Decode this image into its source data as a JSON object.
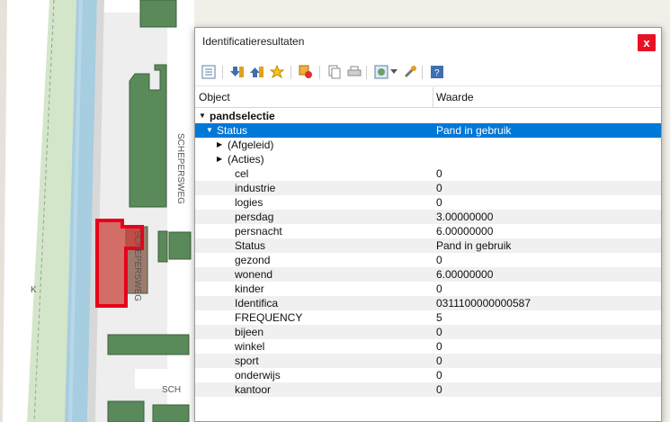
{
  "map": {
    "street_labels": [
      "SCHEPERSWEG",
      "SCHEPERSWEG",
      "SCH",
      "PE",
      "ERS",
      "K"
    ]
  },
  "dialog": {
    "title": "Identificatieresultaten",
    "close_glyph": "x",
    "columns": {
      "object": "Object",
      "value": "Waarde"
    },
    "root_label": "pandselectie",
    "selected": {
      "label": "Status",
      "value": "Pand in gebruik"
    },
    "groups": [
      "(Afgeleid)",
      "(Acties)"
    ],
    "fields": [
      {
        "k": "cel",
        "v": "0"
      },
      {
        "k": "industrie",
        "v": "0"
      },
      {
        "k": "logies",
        "v": "0"
      },
      {
        "k": "persdag",
        "v": "3.00000000"
      },
      {
        "k": "persnacht",
        "v": "6.00000000"
      },
      {
        "k": "Status",
        "v": "Pand in gebruik"
      },
      {
        "k": "gezond",
        "v": "0"
      },
      {
        "k": "wonend",
        "v": "6.00000000"
      },
      {
        "k": "kinder",
        "v": "0"
      },
      {
        "k": "Identifica",
        "v": "0311100000000587"
      },
      {
        "k": "FREQUENCY",
        "v": "5"
      },
      {
        "k": "bijeen",
        "v": "0"
      },
      {
        "k": "winkel",
        "v": "0"
      },
      {
        "k": "sport",
        "v": "0"
      },
      {
        "k": "onderwijs",
        "v": "0"
      },
      {
        "k": "kantoor",
        "v": "0"
      }
    ]
  },
  "colors": {
    "selection": "#0078d7",
    "highlight": "#e8001c",
    "building": "#5b8a5a",
    "water": "#a7cde0"
  },
  "toolbar_icons": [
    "expand-tree-icon",
    "collapse-tree-icon",
    "expand-new-icon",
    "expand-all-icon",
    "clear-results-icon",
    "copy-feature-icon",
    "print-icon",
    "select-features-icon",
    "dropdown-arrow-icon",
    "settings-icon",
    "help-icon"
  ]
}
